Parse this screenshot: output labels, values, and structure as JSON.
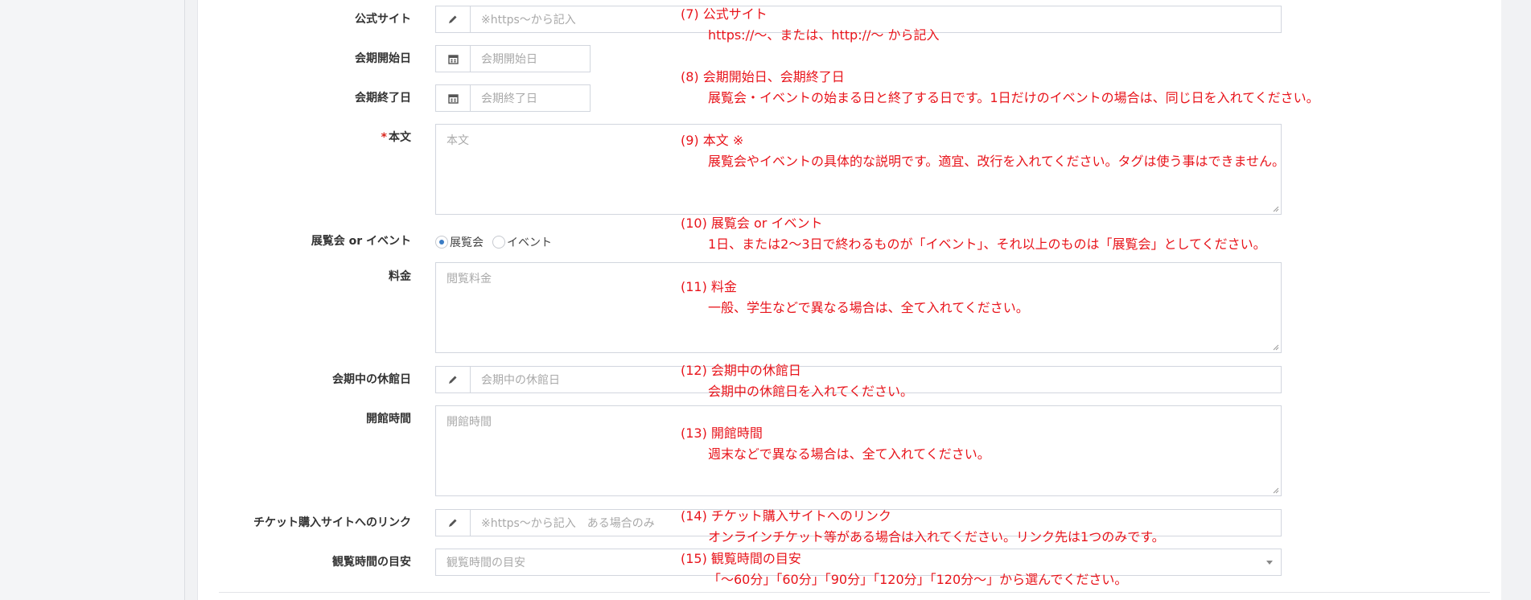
{
  "colors": {
    "annotation": "#e8141b",
    "required": "#d9251c",
    "radio_checked": "#3a7cc4"
  },
  "icons": {
    "pencil": "pencil-icon",
    "calendar": "calendar-icon"
  },
  "fields": {
    "official_site": {
      "label": "公式サイト",
      "placeholder": "※https〜から記入"
    },
    "start_date": {
      "label": "会期開始日",
      "placeholder": "会期開始日"
    },
    "end_date": {
      "label": "会期終了日",
      "placeholder": "会期終了日"
    },
    "body": {
      "required_mark": "*",
      "label": "本文",
      "placeholder": "本文"
    },
    "type": {
      "label": "展覧会 or イベント",
      "options": [
        "展覧会",
        "イベント"
      ],
      "selected": "展覧会"
    },
    "fee": {
      "label": "料金",
      "placeholder": "閲覧料金"
    },
    "closed_days": {
      "label": "会期中の休館日",
      "placeholder": "会期中の休館日"
    },
    "hours": {
      "label": "開館時間",
      "placeholder": "開館時間"
    },
    "ticket_link": {
      "label": "チケット購入サイトへのリンク",
      "placeholder": "※https〜から記入　ある場合のみ"
    },
    "viewing_time": {
      "label": "観覧時間の目安",
      "placeholder": "観覧時間の目安"
    }
  },
  "notes": [
    {
      "title": "(7) 公式サイト",
      "desc": "https://〜、または、http://〜 から記入"
    },
    {
      "title": "(8) 会期開始日、会期終了日",
      "desc": "展覧会・イベントの始まる日と終了する日です。1日だけのイベントの場合は、同じ日を入れてください。"
    },
    {
      "title": "(9) 本文 ※",
      "desc": "展覧会やイベントの具体的な説明です。適宜、改行を入れてください。タグは使う事はできません。"
    },
    {
      "title": "(10) 展覧会 or イベント",
      "desc": "1日、または2〜3日で終わるものが「イベント」、それ以上のものは「展覧会」としてください。"
    },
    {
      "title": "(11) 料金",
      "desc": "一般、学生などで異なる場合は、全て入れてください。"
    },
    {
      "title": "(12) 会期中の休館日",
      "desc": "会期中の休館日を入れてください。"
    },
    {
      "title": "(13) 開館時間",
      "desc": "週末などで異なる場合は、全て入れてください。"
    },
    {
      "title": "(14) チケット購入サイトへのリンク",
      "desc": "オンラインチケット等がある場合は入れてください。リンク先は1つのみです。"
    },
    {
      "title": "(15) 観覧時間の目安",
      "desc": "「〜60分」「60分」「90分」「120分」「120分〜」から選んでください。"
    }
  ]
}
